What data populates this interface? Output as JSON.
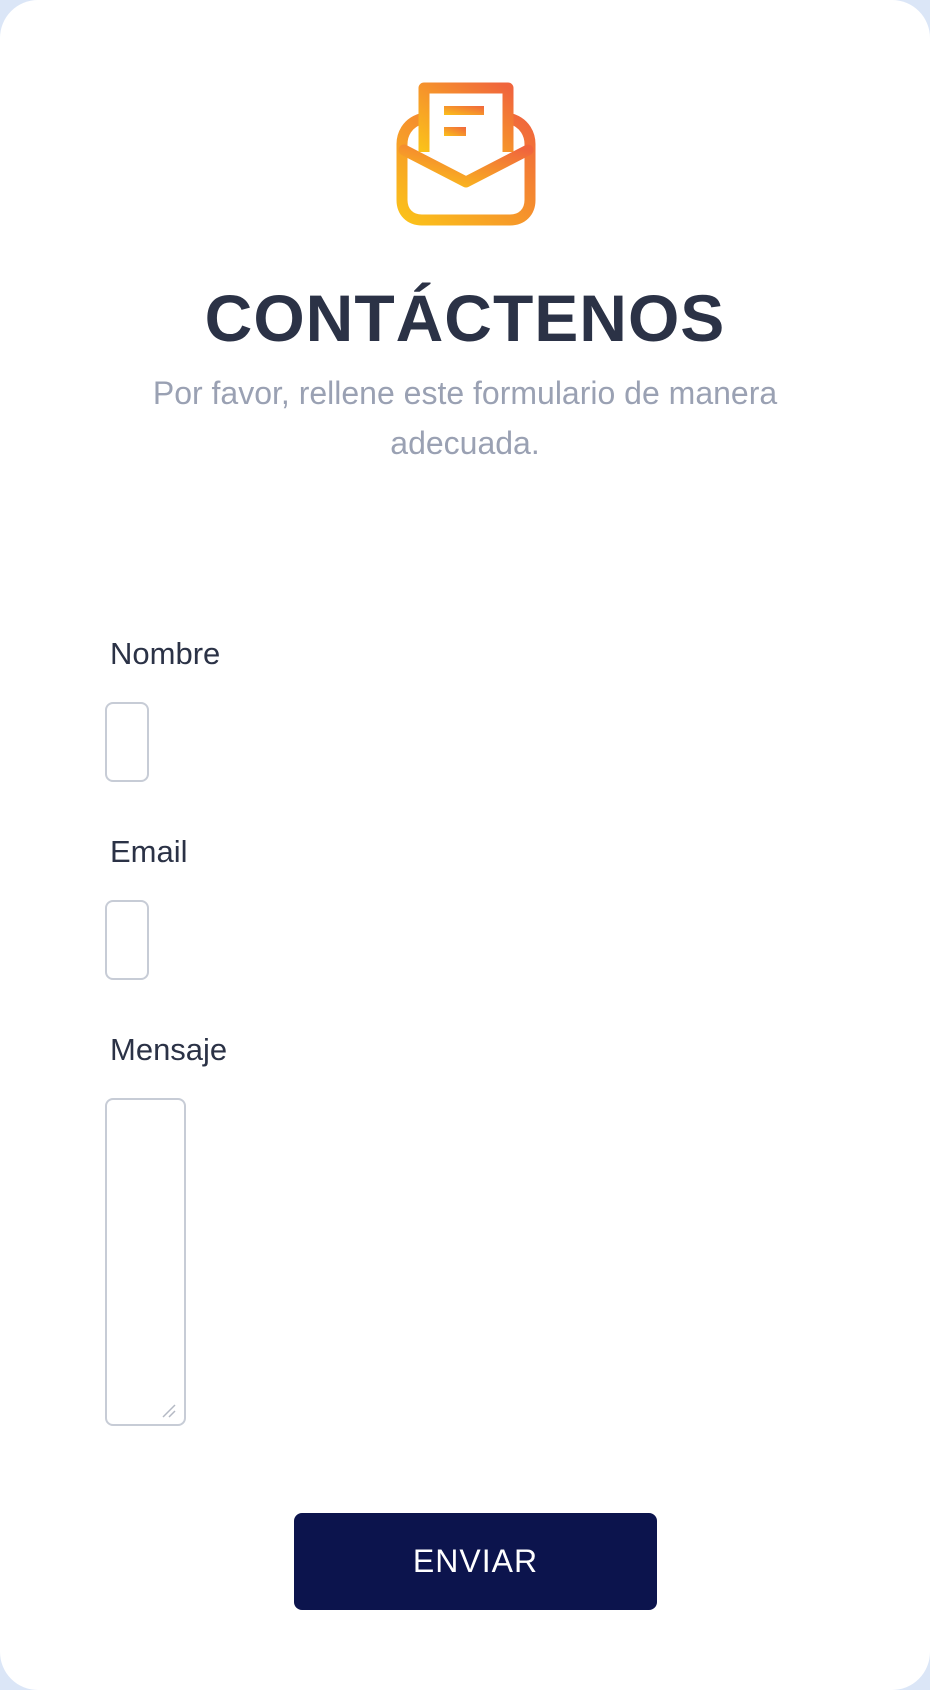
{
  "header": {
    "icon": "open-envelope-letter-icon",
    "title": "CONTÁCTENOS",
    "subtitle": "Por favor, rellene este formulario de manera adecuada."
  },
  "form": {
    "name_label": "Nombre",
    "name_value": "",
    "email_label": "Email",
    "email_value": "",
    "message_label": "Mensaje",
    "message_value": "",
    "submit_label": "ENVIAR"
  },
  "colors": {
    "title": "#2b3246",
    "subtitle": "#9aa1b3",
    "button_bg": "#0c144d",
    "icon_gradient_start": "#fbc21a",
    "icon_gradient_end": "#f0653d",
    "page_bg": "#dbe6f7"
  }
}
